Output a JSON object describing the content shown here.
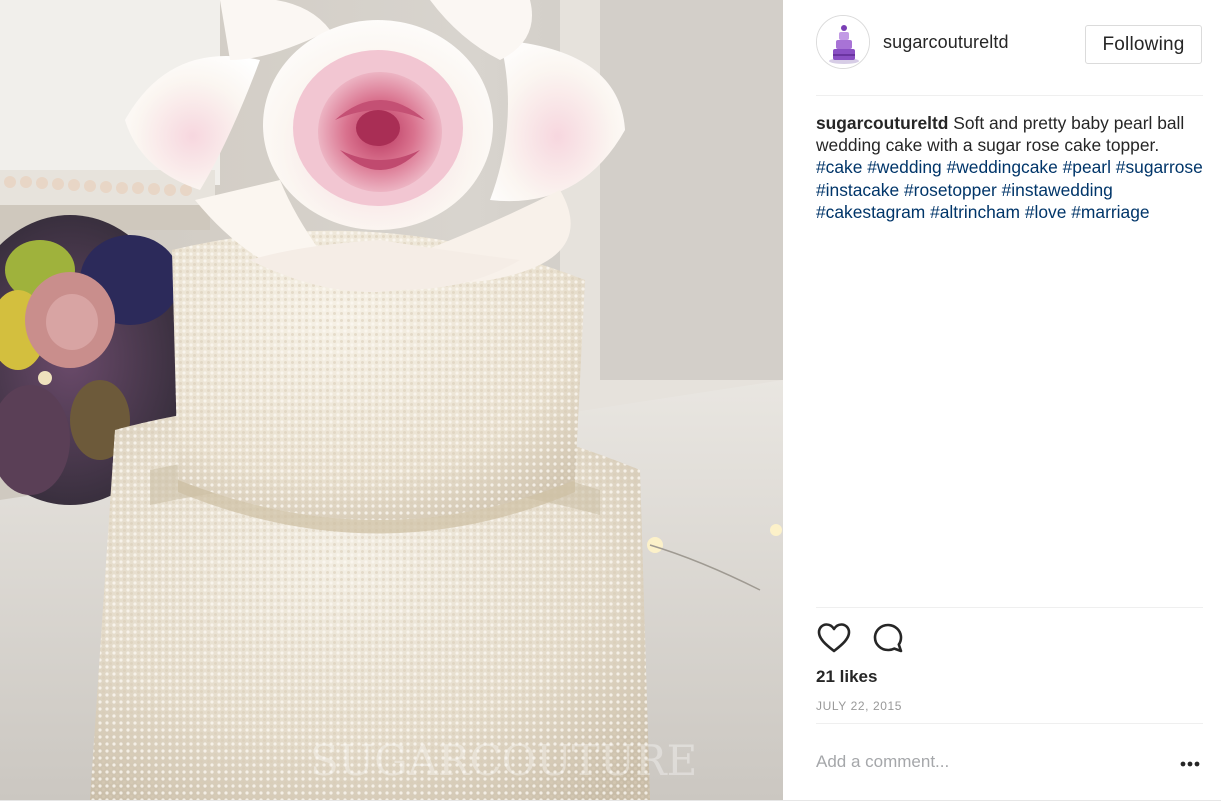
{
  "post": {
    "image": {
      "alt": "Two-tier pearl wedding cake with sugar rose topper",
      "watermark": "SUGARCOUTURE"
    },
    "author": {
      "username": "sugarcoutureltd",
      "avatar_icon": "tiered-cake-logo"
    },
    "follow_label": "Following",
    "caption": {
      "username": "sugarcoutureltd",
      "text": "Soft and pretty baby pearl ball wedding cake with a sugar rose cake topper.",
      "hashtags": [
        "#cake",
        "#wedding",
        "#weddingcake",
        "#pearl",
        "#sugarrose",
        "#instacake",
        "#rosetopper",
        "#instawedding",
        "#cakestagram",
        "#altrincham",
        "#love",
        "#marriage"
      ]
    },
    "actions": {
      "like_icon": "heart-outline-icon",
      "comment_icon": "speech-bubble-icon",
      "more_icon": "ellipsis-icon"
    },
    "likes": "21 likes",
    "date": "JULY 22, 2015",
    "comment_placeholder": "Add a comment...",
    "colors": {
      "text": "#262626",
      "hashtag": "#003569",
      "muted": "#999999",
      "border": "#dbdbdb"
    }
  }
}
